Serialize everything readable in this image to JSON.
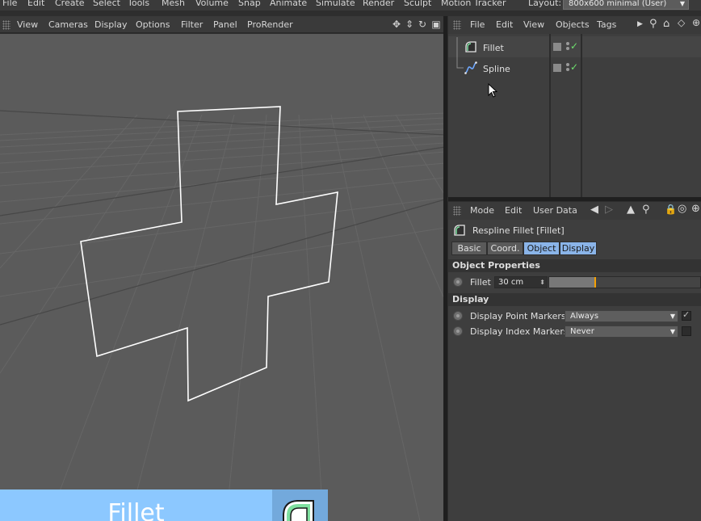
{
  "main_menu": [
    "File",
    "Edit",
    "Create",
    "Select",
    "Tools",
    "Mesh",
    "Volume",
    "Snap",
    "Animate",
    "Simulate",
    "Render",
    "Sculpt",
    "Motion Tracker"
  ],
  "layout": {
    "label": "Layout:",
    "value": "800x600 minimal (User)"
  },
  "viewport_menu": [
    "View",
    "Cameras",
    "Display",
    "Options",
    "Filter",
    "Panel",
    "ProRender"
  ],
  "viewport_icons": [
    "move-view-icon",
    "dolly-view-icon",
    "rotate-view-icon",
    "maximize-view-icon"
  ],
  "banner": {
    "text": "Fillet",
    "color": "#8cc8ff"
  },
  "object_manager": {
    "menu": [
      "File",
      "Edit",
      "View",
      "Objects",
      "Tags"
    ],
    "objects": [
      {
        "name": "Fillet",
        "icon": "fillet-icon"
      },
      {
        "name": "Spline",
        "icon": "spline-icon"
      }
    ]
  },
  "attribute_manager": {
    "menu": [
      "Mode",
      "Edit",
      "User Data"
    ],
    "title": "Respline Fillet [Fillet]",
    "tabs": [
      {
        "label": "Basic",
        "active": false
      },
      {
        "label": "Coord.",
        "active": false
      },
      {
        "label": "Object",
        "active": true
      },
      {
        "label": "Display",
        "active": true
      }
    ],
    "sections": {
      "object_properties": "Object Properties",
      "display": "Display"
    },
    "fillet": {
      "label": "Fillet",
      "value": "30 cm",
      "slider_fraction": 0.3
    },
    "display_point_markers": {
      "label": "Display Point Markers",
      "value": "Always",
      "checked": true
    },
    "display_index_markers": {
      "label": "Display Index Markers",
      "value": "Never",
      "checked": false
    }
  },
  "colors": {
    "accent": "#8ab4e8",
    "check_green": "#6ee06e",
    "slider_knob": "#f5a000"
  }
}
